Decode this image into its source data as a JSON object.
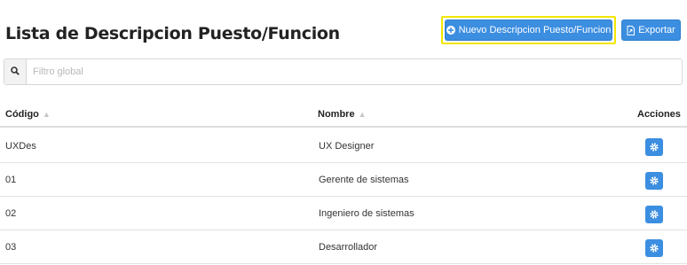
{
  "header": {
    "title": "Lista de Descripcion Puesto/Funcion",
    "new_button_label": "Nuevo Descripcion Puesto/Funcion",
    "export_button_label": "Exportar"
  },
  "search": {
    "placeholder": "Filtro global",
    "value": ""
  },
  "table": {
    "columns": [
      "Código",
      "Nombre",
      "Acciones"
    ],
    "rows": [
      {
        "codigo": "UXDes",
        "nombre": "UX Designer"
      },
      {
        "codigo": "01",
        "nombre": "Gerente de sistemas"
      },
      {
        "codigo": "02",
        "nombre": "Ingeniero de sistemas"
      },
      {
        "codigo": "03",
        "nombre": "Desarrollador"
      }
    ]
  },
  "icons": {
    "new": "plus-circle-icon",
    "export": "file-export-icon",
    "search": "search-icon",
    "sort": "sort-icon",
    "row_action": "gear-icon"
  },
  "colors": {
    "primary": "#3b8ee0",
    "highlight": "#f2e600"
  }
}
